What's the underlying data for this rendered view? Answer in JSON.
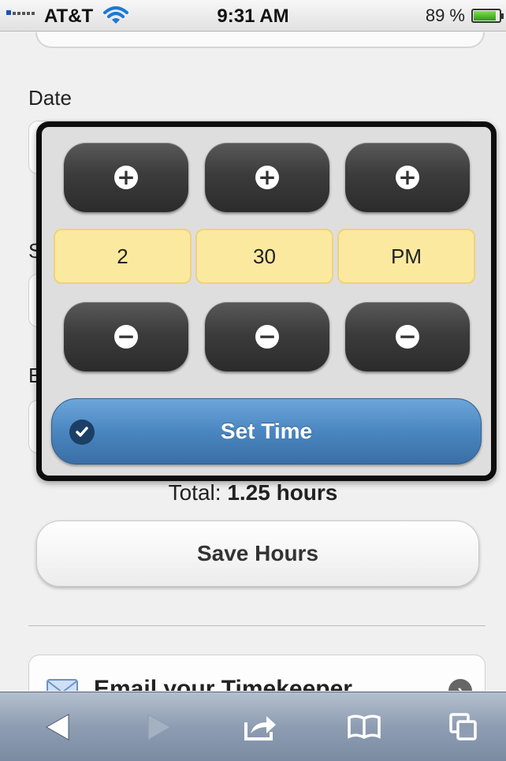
{
  "status_bar": {
    "carrier": "AT&T",
    "time": "9:31 AM",
    "battery_percent": "89 %",
    "battery_level": 0.89
  },
  "form": {
    "date_label": "Date",
    "start_label_partial": "S",
    "end_label_partial": "E",
    "total_prefix": "Total:",
    "total_value": "1.25 hours",
    "save_button": "Save Hours",
    "email_link": "Email your Timekeeper"
  },
  "time_picker": {
    "hour": "2",
    "minute": "30",
    "ampm": "PM",
    "set_button": "Set Time",
    "increment_symbol": "+",
    "decrement_symbol": "−"
  },
  "toolbar": {
    "icons": [
      "back-icon",
      "forward-icon",
      "share-icon",
      "bookmarks-icon",
      "tabs-icon"
    ]
  },
  "colors": {
    "value_bg": "#fbe9a0",
    "set_button": "#4a86c1",
    "spin_button": "#3c3c3c"
  }
}
